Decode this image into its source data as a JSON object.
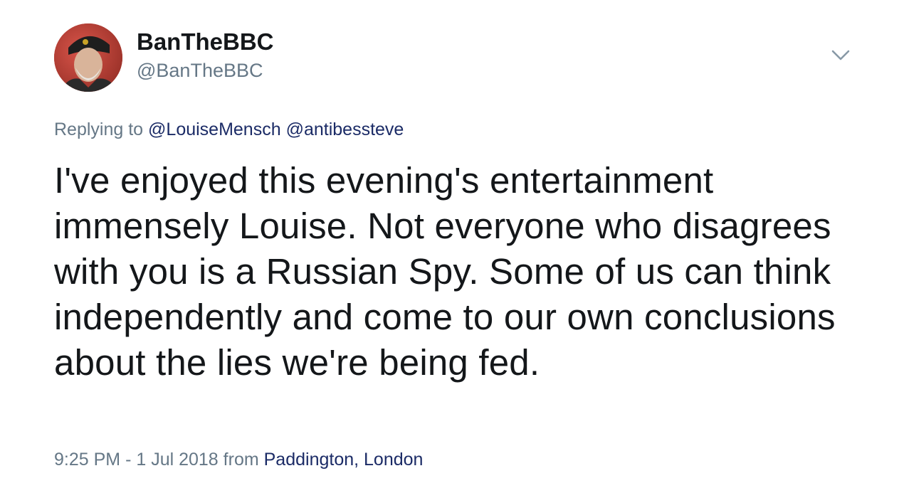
{
  "user": {
    "display_name": "BanTheBBC",
    "handle": "@BanTheBBC"
  },
  "reply": {
    "prefix": "Replying to",
    "mentions": [
      "@LouiseMensch",
      "@antibessteve"
    ]
  },
  "text": "I've enjoyed this evening's entertainment immensely Louise. Not everyone who disagrees with you is a Russian Spy. Some of us can think independently and come to our own conclusions about the lies we're being fed.",
  "meta": {
    "time": "9:25 PM",
    "separator": "-",
    "date": "1 Jul 2018",
    "from_label": "from",
    "location": "Paddington, London"
  },
  "icons": {
    "menu": "chevron-down-icon",
    "avatar": "avatar"
  },
  "colors": {
    "text": "#14171a",
    "secondary": "#657786",
    "link": "#1b2b66"
  }
}
